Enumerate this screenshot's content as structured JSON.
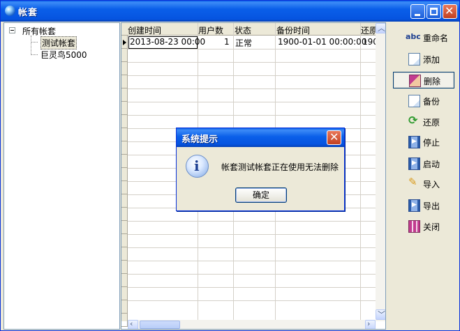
{
  "window": {
    "title": "帐套"
  },
  "tree": {
    "root": "所有帐套",
    "children": [
      "测试帐套",
      "巨灵鸟5000"
    ]
  },
  "grid": {
    "headers": [
      "创建时间",
      "用户数",
      "状态",
      "备份时间",
      "还原"
    ],
    "rows": [
      [
        "2013-08-23 00:00",
        "1",
        "正常",
        "1900-01-01 00:00:00",
        "190"
      ]
    ]
  },
  "toolbar": {
    "buttons": [
      {
        "label": "重命名",
        "icon": "rename-abc-icon"
      },
      {
        "label": "添加",
        "icon": "document-icon"
      },
      {
        "label": "删除",
        "icon": "eraser-icon"
      },
      {
        "label": "备份",
        "icon": "document-icon"
      },
      {
        "label": "还原",
        "icon": "refresh-arrows-icon"
      },
      {
        "label": "停止",
        "icon": "stop-icon"
      },
      {
        "label": "启动",
        "icon": "start-icon"
      },
      {
        "label": "导入",
        "icon": "pencil-icon"
      },
      {
        "label": "导出",
        "icon": "export-icon"
      },
      {
        "label": "关闭",
        "icon": "close-door-icon"
      }
    ]
  },
  "dialog": {
    "title": "系统提示",
    "message": "帐套测试帐套正在使用无法删除",
    "ok": "确定",
    "icon": "info-icon"
  },
  "colors": {
    "titlebar": "#0a5fe9",
    "window_bg": "#ece9d8",
    "border": "#7f9db9"
  }
}
